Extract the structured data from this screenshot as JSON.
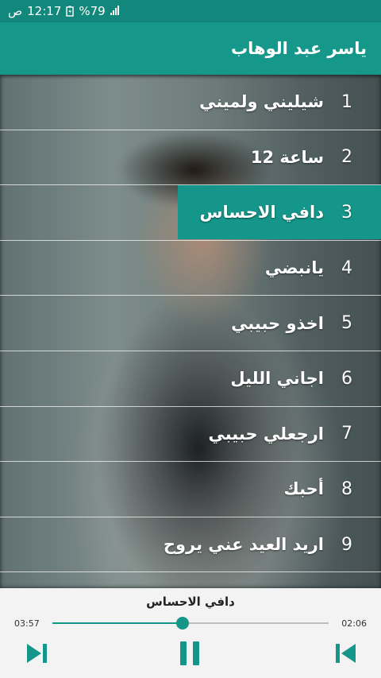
{
  "status_bar": {
    "time": "12:17",
    "suffix": "ص",
    "battery": "%79",
    "icons": [
      "battery-icon",
      "signal-icon"
    ]
  },
  "app_bar": {
    "title": "ياسر عبد الوهاب"
  },
  "songs": [
    {
      "number": "1",
      "title": "شيليني ولميني"
    },
    {
      "number": "2",
      "title": "ساعة 12"
    },
    {
      "number": "3",
      "title": "دافي الاحساس"
    },
    {
      "number": "4",
      "title": "يانبضي"
    },
    {
      "number": "5",
      "title": "اخذو حبيبي"
    },
    {
      "number": "6",
      "title": "اجاني الليل"
    },
    {
      "number": "7",
      "title": "ارجعلي حبيبي"
    },
    {
      "number": "8",
      "title": "أحبك"
    },
    {
      "number": "9",
      "title": "اريد العيد عني يروح"
    }
  ],
  "active_index": 2,
  "player": {
    "now_playing": "دافي الاحساس",
    "elapsed_left": "03:57",
    "elapsed_right": "02:06",
    "progress": 0.47,
    "controls": [
      "next-icon",
      "pause-icon",
      "previous-icon"
    ]
  },
  "colors": {
    "accent": "#15978a",
    "status_bar": "#12877b",
    "player_bg": "#f3f3f3"
  }
}
